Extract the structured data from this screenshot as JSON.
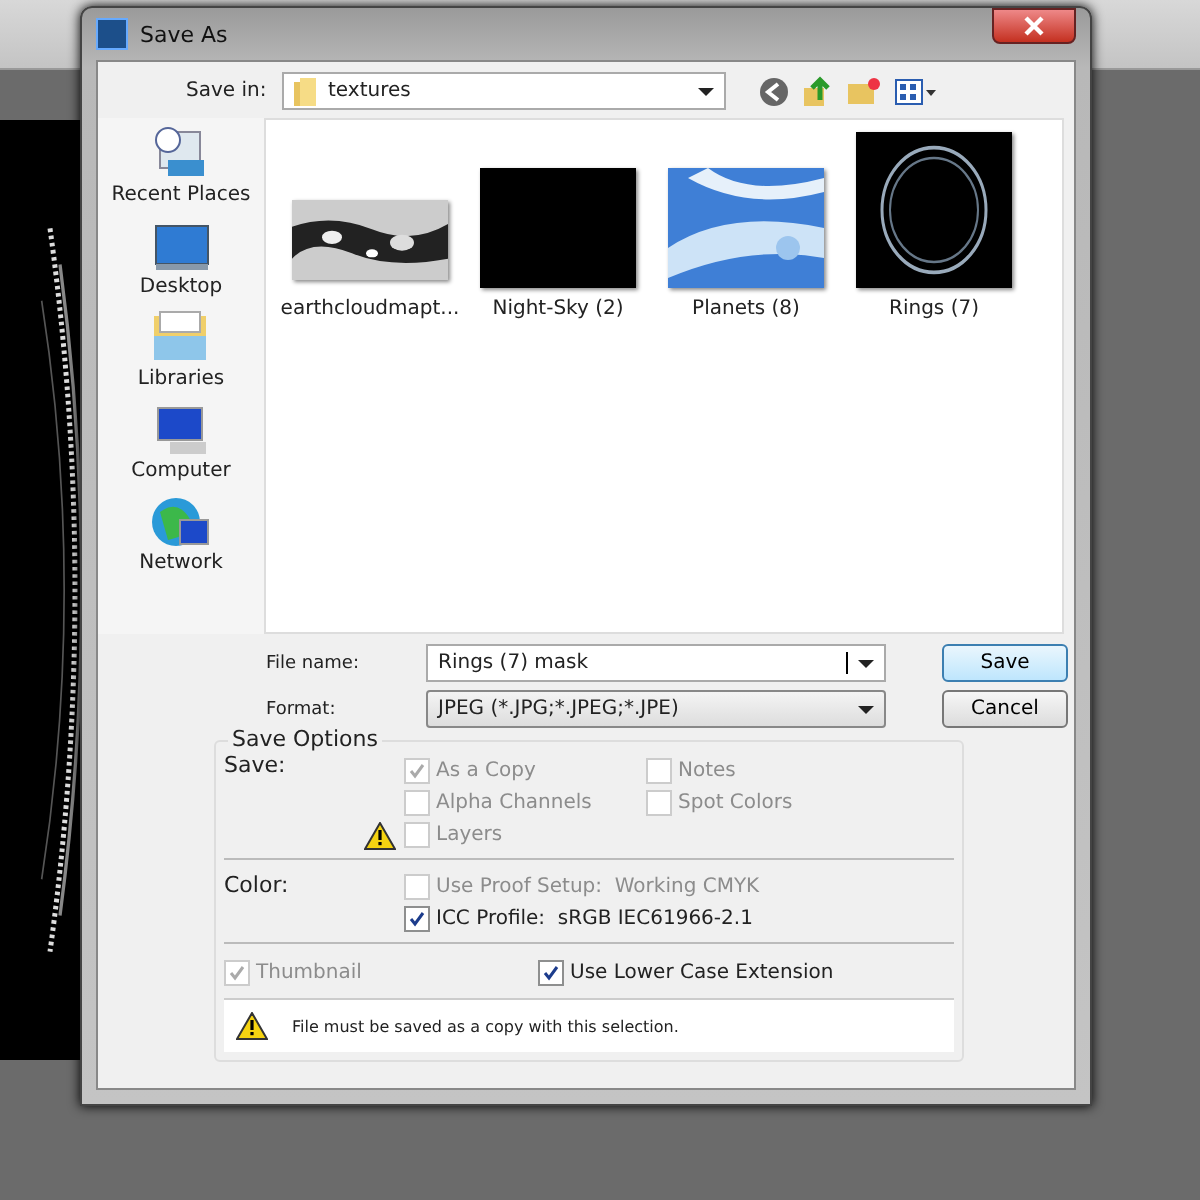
{
  "window": {
    "title": "Save As"
  },
  "save_in": {
    "label": "Save in:",
    "value": "textures"
  },
  "sidebar": {
    "items": [
      {
        "label": "Recent Places",
        "kind": "recent"
      },
      {
        "label": "Desktop",
        "kind": "desktop"
      },
      {
        "label": "Libraries",
        "kind": "libraries"
      },
      {
        "label": "Computer",
        "kind": "computer"
      },
      {
        "label": "Network",
        "kind": "network"
      }
    ]
  },
  "files": [
    {
      "label": "earthcloudmapt...",
      "kind": "clouds"
    },
    {
      "label": "Night-Sky (2)",
      "kind": "black"
    },
    {
      "label": "Planets (8)",
      "kind": "sky"
    },
    {
      "label": "Rings (7)",
      "kind": "rings"
    }
  ],
  "file_name": {
    "label": "File name:",
    "value": "Rings (7) mask"
  },
  "format": {
    "label": "Format:",
    "value": "JPEG (*.JPG;*.JPEG;*.JPE)"
  },
  "buttons": [
    {
      "label": "Save",
      "kind": "default"
    },
    {
      "label": "Cancel",
      "kind": "normal"
    }
  ],
  "save_options": {
    "title": "Save Options",
    "save_label": "Save:",
    "save_checks": [
      {
        "label": "As a Copy",
        "checked": true,
        "disabled": true
      },
      {
        "label": "Notes",
        "checked": false,
        "disabled": true
      },
      {
        "label": "Alpha Channels",
        "checked": false,
        "disabled": true
      },
      {
        "label": "Spot Colors",
        "checked": false,
        "disabled": true
      },
      {
        "label": "Layers",
        "checked": false,
        "disabled": true,
        "warning": true
      }
    ],
    "color_label": "Color:",
    "color_checks": [
      {
        "label": "Use Proof Setup:  Working CMYK",
        "checked": false,
        "disabled": true
      },
      {
        "label": "ICC Profile:  sRGB IEC61966-2.1",
        "checked": true,
        "disabled": false
      }
    ],
    "bottom_checks": [
      {
        "label": "Thumbnail",
        "checked": true,
        "disabled": true
      },
      {
        "label": "Use Lower Case Extension",
        "checked": true,
        "disabled": false
      }
    ],
    "message": "File must be saved as a copy with this selection."
  }
}
